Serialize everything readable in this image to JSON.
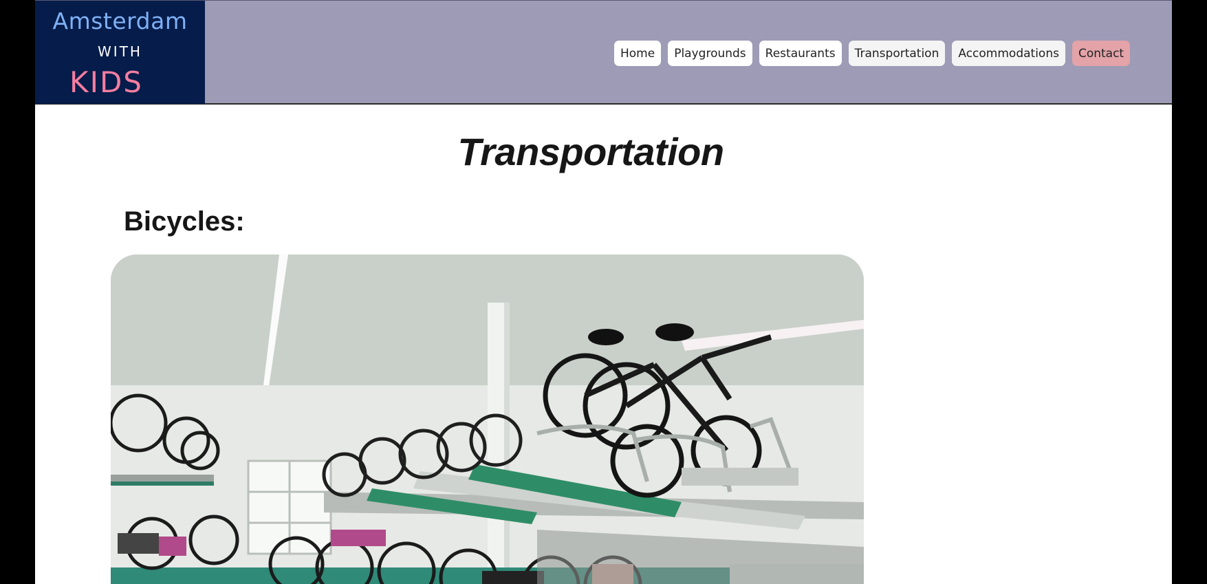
{
  "logo": {
    "line1": "Amsterdam",
    "line2": "WITH",
    "line3": "KIDS"
  },
  "nav": {
    "items": [
      {
        "label": "Home"
      },
      {
        "label": "Playgrounds"
      },
      {
        "label": "Restaurants"
      },
      {
        "label": "Transportation"
      },
      {
        "label": "Accommodations"
      },
      {
        "label": "Contact"
      }
    ]
  },
  "main": {
    "title": "Transportation",
    "section_heading": "Bicycles:"
  },
  "colors": {
    "header_bg": "#9d9bb5",
    "logo_bg": "#061c4a",
    "contact_button": "#e3a3a8"
  }
}
